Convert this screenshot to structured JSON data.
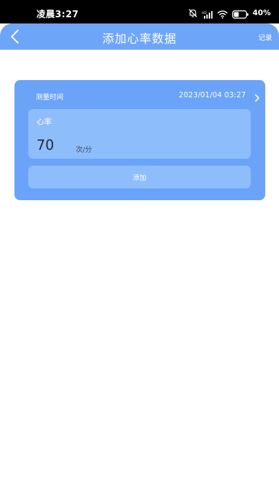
{
  "status_bar": {
    "time": "凌晨3:27",
    "battery_text": "40%",
    "icons": [
      "mute-bell-icon",
      "hd-signal-icon",
      "wifi-icon",
      "battery-icon"
    ]
  },
  "header": {
    "title": "添加心率数据",
    "record_label": "记录",
    "back_icon": "chevron-left-icon"
  },
  "form": {
    "time_label": "测量时间",
    "time_value": "2023/01/04 03:27",
    "heart_rate_label": "心率",
    "heart_rate_value": "70",
    "heart_rate_unit": "次/分",
    "add_label": "添加"
  },
  "colors": {
    "header_bg": "#6da5f9",
    "card_bg": "#6aa3f8",
    "field_bg": "#8ebdfc",
    "status_bar_bg": "#000000"
  }
}
